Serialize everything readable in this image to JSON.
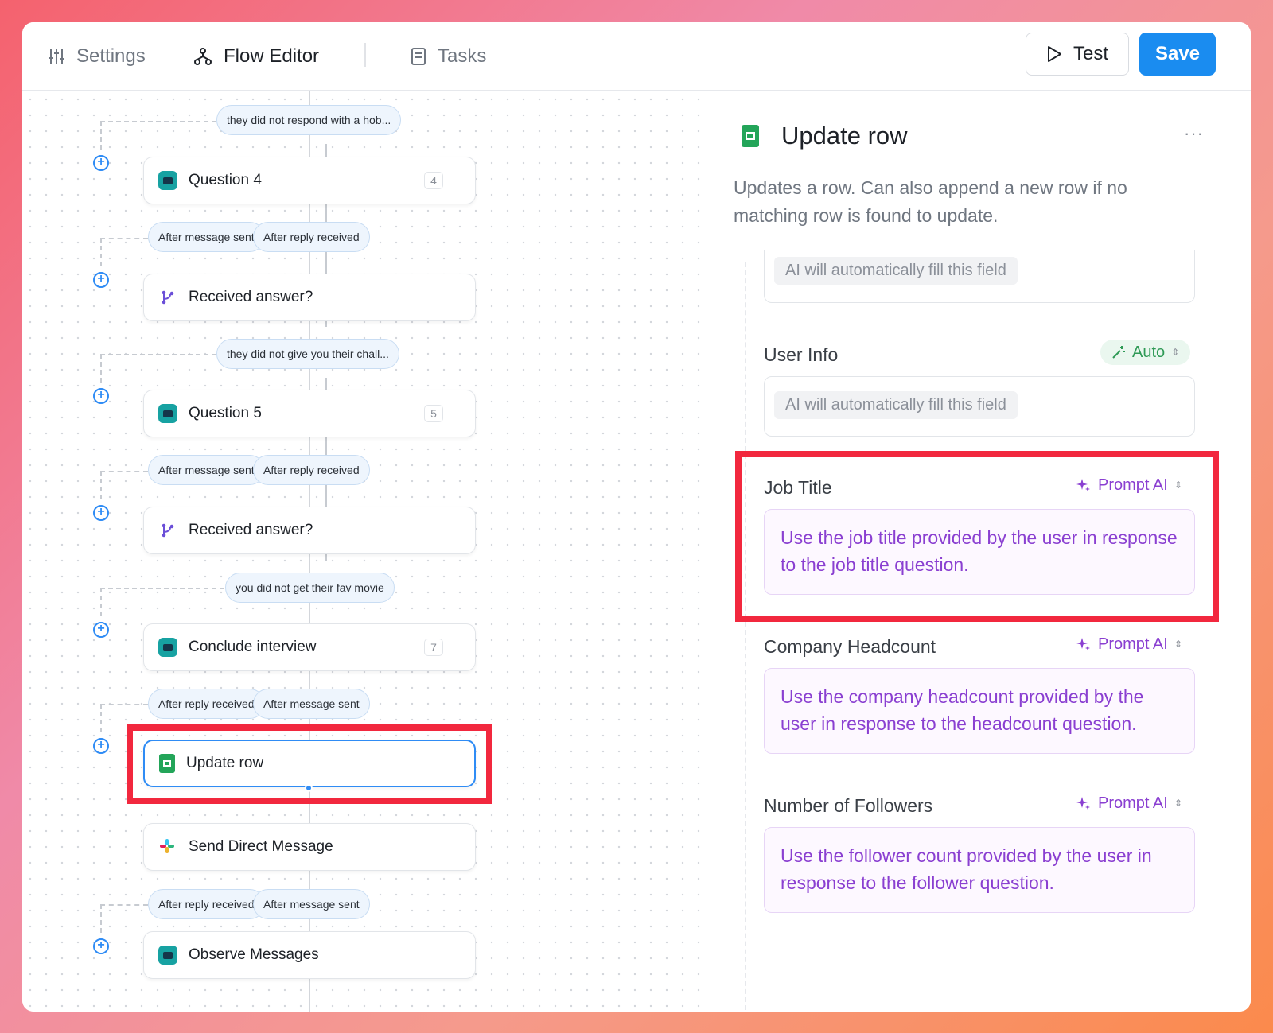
{
  "tabs": [
    {
      "label": "Settings",
      "icon": "sliders-icon"
    },
    {
      "label": "Flow Editor",
      "icon": "flow-icon"
    },
    {
      "label": "Tasks",
      "icon": "tasks-icon"
    }
  ],
  "actions": {
    "test_label": "Test",
    "save_label": "Save"
  },
  "flow": {
    "pills": [
      "they did not respond with a hob...",
      "After message sent",
      "After reply received",
      "they did not give you their chall...",
      "After message sent",
      "After reply received",
      "you did not get their fav movie",
      "After reply received",
      "After message sent",
      "After reply received",
      "After message sent"
    ],
    "nodes": [
      {
        "label": "Question 4",
        "badge": "4",
        "icon": "question-icon"
      },
      {
        "label": "Received answer?",
        "badge": "",
        "icon": "branch-icon"
      },
      {
        "label": "Question 5",
        "badge": "5",
        "icon": "question-icon"
      },
      {
        "label": "Received answer?",
        "badge": "",
        "icon": "branch-icon"
      },
      {
        "label": "Conclude interview",
        "badge": "7",
        "icon": "question-icon"
      },
      {
        "label": "Update row",
        "badge": "",
        "icon": "sheets-icon"
      },
      {
        "label": "Send Direct Message",
        "badge": "",
        "icon": "slack-icon"
      },
      {
        "label": "Observe Messages",
        "badge": "",
        "icon": "question-icon"
      }
    ],
    "plus_symbol": "+"
  },
  "panel": {
    "title": "Update row",
    "more": "···",
    "description": "Updates a row. Can also append a new row if no matching row is found to update.",
    "top_field_value": "AI will automatically fill this field",
    "fields": [
      {
        "label": "User Info",
        "mode": "Auto",
        "value": "AI will automatically fill this field"
      },
      {
        "label": "Job Title",
        "mode": "Prompt AI",
        "value": "Use the job title provided by the user in response to the job title question."
      },
      {
        "label": "Company Headcount",
        "mode": "Prompt AI",
        "value": "Use the company headcount provided by the user in response to the headcount question."
      },
      {
        "label": "Number of Followers",
        "mode": "Prompt AI",
        "value": "Use the follower count provided by the user in response to the follower question."
      }
    ]
  },
  "colors": {
    "primary": "#1a8cf0",
    "highlight": "#f2283e",
    "prompt": "#8a3fd1",
    "auto": "#2f9a56"
  }
}
